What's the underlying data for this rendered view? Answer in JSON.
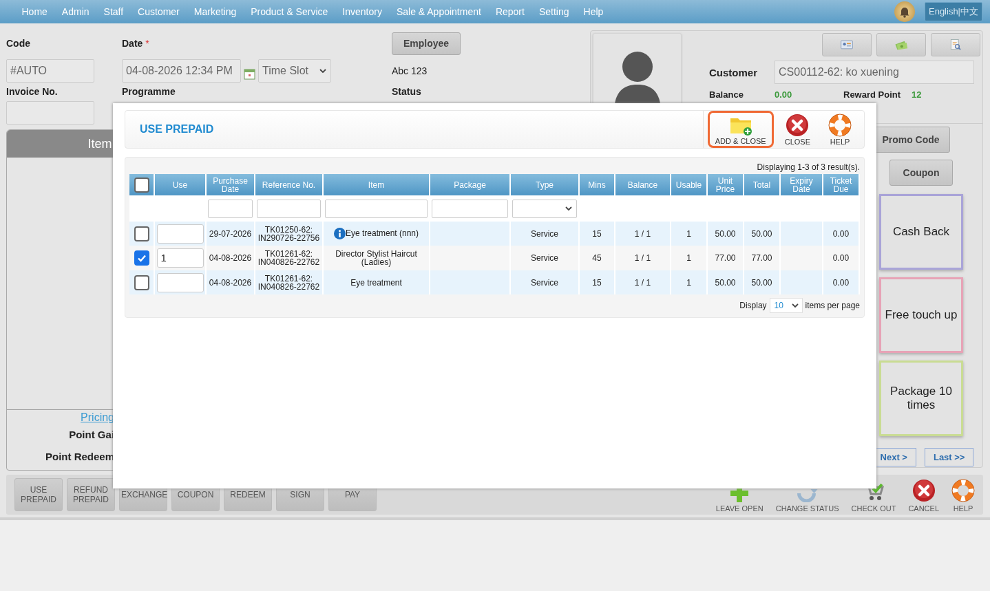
{
  "nav": {
    "items": [
      "Home",
      "Admin",
      "Staff",
      "Customer",
      "Marketing",
      "Product & Service",
      "Inventory",
      "Sale & Appointment",
      "Report",
      "Setting",
      "Help"
    ],
    "language": "English|中文"
  },
  "form": {
    "code_label": "Code",
    "code_value": "#AUTO",
    "date_label": "Date",
    "date_required": "*",
    "date_value": "04-08-2026 12:34 PM",
    "time_slot_placeholder": "Time Slot",
    "employee_button": "Employee",
    "employee_value": "Abc 123",
    "invoice_label": "Invoice No.",
    "programme_label": "Programme",
    "status_label": "Status"
  },
  "items_panel": {
    "header": "Item",
    "pricing_link": "Pricing",
    "point_gain_label": "Point Gai",
    "point_redeem_label": "Point Redeem"
  },
  "actions": [
    {
      "label": "USE PREPAID"
    },
    {
      "label": "REFUND PREPAID"
    },
    {
      "label": "EXCHANGE"
    },
    {
      "label": "COUPON"
    },
    {
      "label": "REDEEM"
    },
    {
      "label": "SIGN"
    },
    {
      "label": "PAY"
    }
  ],
  "footer_actions": [
    {
      "label": "LEAVE OPEN",
      "kind": "plus"
    },
    {
      "label": "CHANGE STATUS",
      "kind": "refresh"
    },
    {
      "label": "CHECK OUT",
      "kind": "cart"
    },
    {
      "label": "CANCEL",
      "kind": "close"
    },
    {
      "label": "HELP",
      "kind": "help"
    }
  ],
  "customer": {
    "label": "Customer",
    "value": "CS00112-62: ko xuening",
    "balance_label": "Balance",
    "balance": "0.00",
    "reward_label": "Reward Point",
    "reward": "12"
  },
  "promotions": {
    "promo_button": "Promo Code",
    "coupon_button": "Coupon",
    "tiles": [
      {
        "label": "Cash Back",
        "color": "#a9a4d8"
      },
      {
        "label": "Free touch up",
        "color": "#e7a3b6"
      },
      {
        "label": "Package 10 times",
        "color": "#c9dc93"
      }
    ],
    "next": "Next >",
    "last": "Last >>"
  },
  "dialog": {
    "title": "USE PREPAID",
    "tools": [
      {
        "label": "ADD & CLOSE",
        "kind": "add",
        "highlighted": true
      },
      {
        "label": "CLOSE",
        "kind": "close",
        "highlighted": false
      },
      {
        "label": "HELP",
        "kind": "help",
        "highlighted": false
      }
    ],
    "result_info": "Displaying 1-3 of 3 result(s).",
    "table": {
      "select_all": false,
      "columns": [
        {
          "label": "Use",
          "kind": "plain"
        },
        {
          "label": "Purchase Date",
          "kind": "searchable"
        },
        {
          "label": "Reference No.",
          "kind": "searchable"
        },
        {
          "label": "Item",
          "kind": "searchable"
        },
        {
          "label": "Package",
          "kind": "searchable"
        },
        {
          "label": "Type",
          "kind": "dropdown"
        },
        {
          "label": "Mins",
          "kind": "plain"
        },
        {
          "label": "Balance",
          "kind": "plain"
        },
        {
          "label": "Usable",
          "kind": "plain"
        },
        {
          "label": "Unit Price",
          "kind": "plain"
        },
        {
          "label": "Total",
          "kind": "plain"
        },
        {
          "label": "Expiry Date",
          "kind": "plain"
        },
        {
          "label": "Ticket Due",
          "kind": "plain"
        }
      ],
      "rows": [
        {
          "selected": false,
          "info": true,
          "purchase_date": "29-07-2026",
          "reference": "TK01250-62: IN290726-22756",
          "item": "Eye treatment (nnn)",
          "type": "Service",
          "mins": "15",
          "balance": "1 / 1",
          "usable": "1",
          "unit_price": "50.00",
          "total": "50.00",
          "ticket_due": "0.00"
        },
        {
          "selected": true,
          "info": false,
          "use": "1",
          "purchase_date": "04-08-2026",
          "reference": "TK01261-62: IN040826-22762",
          "item": "Director Stylist Haircut (Ladies)",
          "type": "Service",
          "mins": "45",
          "balance": "1 / 1",
          "usable": "1",
          "unit_price": "77.00",
          "total": "77.00",
          "ticket_due": "0.00"
        },
        {
          "selected": false,
          "info": false,
          "purchase_date": "04-08-2026",
          "reference": "TK01261-62: IN040826-22762",
          "item": "Eye treatment",
          "type": "Service",
          "mins": "15",
          "balance": "1 / 1",
          "usable": "1",
          "unit_price": "50.00",
          "total": "50.00",
          "ticket_due": "0.00"
        }
      ]
    },
    "pager": {
      "display_label": "Display",
      "page_size": "10",
      "per_page_label": "items per page"
    }
  }
}
